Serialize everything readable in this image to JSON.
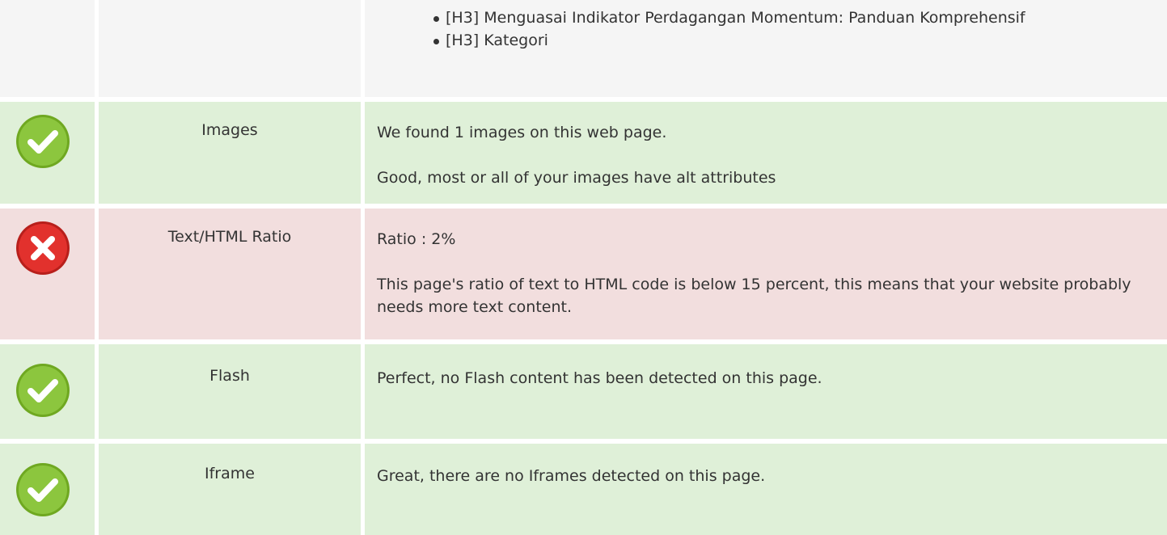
{
  "headings_list": [
    "[H3] Menguasai Indikator Perdagangan Momentum: Panduan Komprehensif",
    "[H3] Kategori"
  ],
  "checks": [
    {
      "status": "pass",
      "label": "Images",
      "lines": [
        "We found 1 images on this web page.",
        "Good, most or all of your images have alt attributes"
      ]
    },
    {
      "status": "fail",
      "label": "Text/HTML Ratio",
      "lines": [
        "Ratio : 2%",
        "This page's ratio of text to HTML code is below 15 percent, this means that your website probably needs more text content."
      ]
    },
    {
      "status": "pass",
      "label": "Flash",
      "lines": [
        "Perfect, no Flash content has been detected on this page."
      ]
    },
    {
      "status": "pass",
      "label": "Iframe",
      "lines": [
        "Great, there are no Iframes detected on this page."
      ]
    }
  ],
  "colors": {
    "pass_bg": "#dff0d8",
    "fail_bg": "#f2dede",
    "neutral_bg": "#f5f5f5",
    "pass_icon": "#8cc63e",
    "fail_icon": "#e2312d"
  }
}
